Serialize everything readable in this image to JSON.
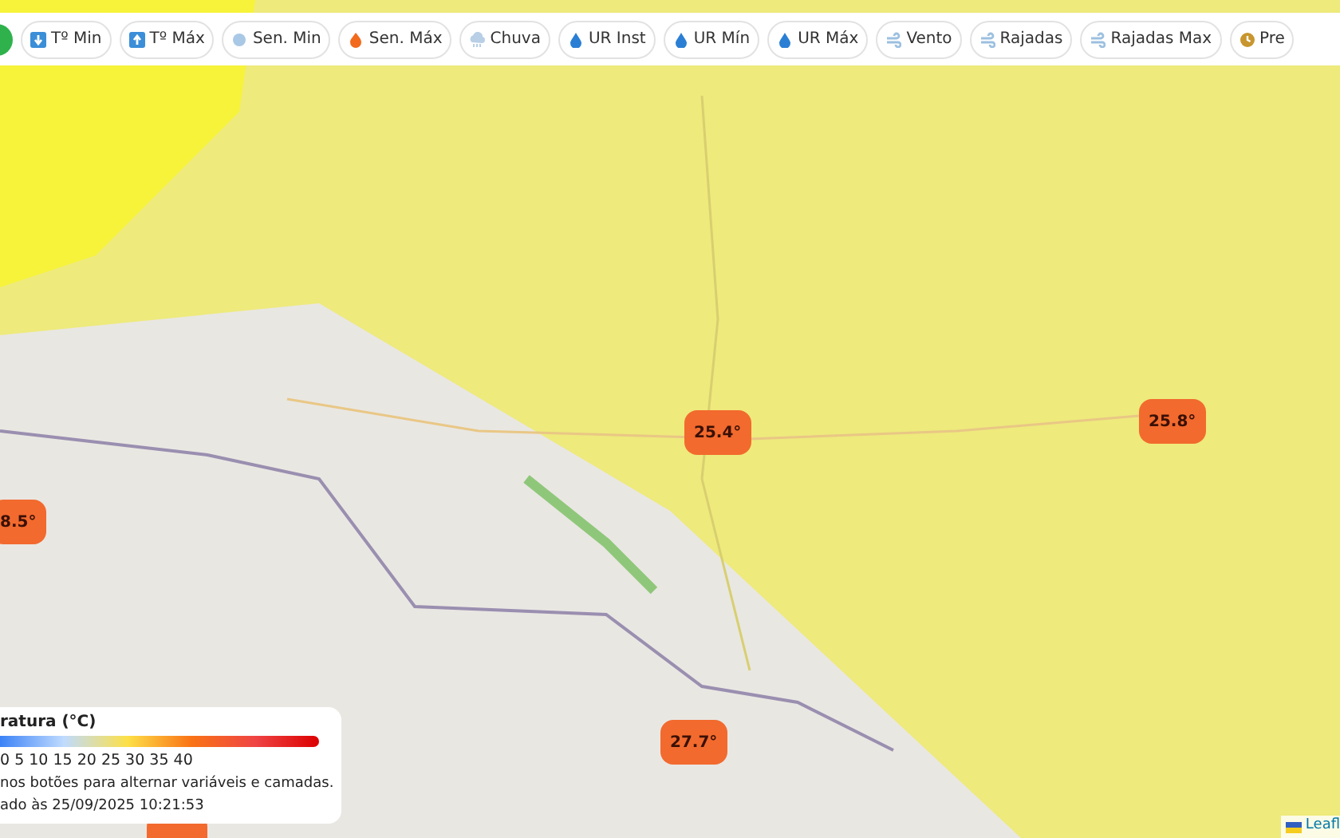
{
  "toolbar": {
    "buttons": [
      {
        "label": "Tº Min"
      },
      {
        "label": "Tº Máx"
      },
      {
        "label": "Sen. Min"
      },
      {
        "label": "Sen. Máx"
      },
      {
        "label": "Chuva"
      },
      {
        "label": "UR Inst"
      },
      {
        "label": "UR Mín"
      },
      {
        "label": "UR Máx"
      },
      {
        "label": "Vento"
      },
      {
        "label": "Rajadas"
      },
      {
        "label": "Rajadas Max"
      },
      {
        "label": "Pre"
      }
    ]
  },
  "markers": [
    {
      "value": "25.4°",
      "color": "#f26a2e"
    },
    {
      "value": "25.8°",
      "color": "#f26a2e"
    },
    {
      "value": "8.5°",
      "color": "#f26a2e"
    },
    {
      "value": "27.7°",
      "color": "#f26a2e"
    }
  ],
  "legend": {
    "title": "ratura (°C)",
    "scale": "0 5 10 15 20 25 30 35 40",
    "hint": "nos botões para alternar variáveis e camadas.",
    "updated": "ado às 25/09/2025 10:21:53"
  },
  "attribution": "Leafl"
}
